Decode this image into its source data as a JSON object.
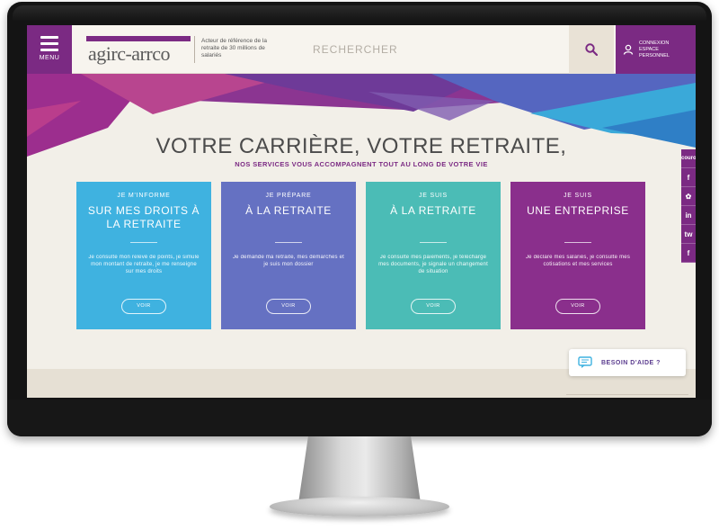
{
  "header": {
    "menu_label": "MENU",
    "logo_text": "agirc-arrco",
    "tagline": "Acteur de référence de la retraite de 30 millions de salariés",
    "search_placeholder": "RECHERCHER",
    "account_label": "CONNEXION ESPACE PERSONNEL"
  },
  "hero": {
    "title": "VOTRE CARRIÈRE, VOTRE RETRAITE,",
    "subtitle": "NOS SERVICES VOUS ACCOMPAGNENT TOUT AU LONG DE VOTRE VIE"
  },
  "cards": [
    {
      "kicker": "JE M'INFORME",
      "title": "SUR MES DROITS À LA RETRAITE",
      "description": "Je consulte mon relevé de points, je simule mon montant de retraite, je me renseigne sur mes droits",
      "cta": "VOIR",
      "color": "#3fb2e0"
    },
    {
      "kicker": "JE PRÉPARE",
      "title": "À LA RETRAITE",
      "description": "Je demande ma retraite, mes démarches et je suis mon dossier",
      "cta": "VOIR",
      "color": "#6571c2"
    },
    {
      "kicker": "JE SUIS",
      "title": "À LA RETRAITE",
      "description": "Je consulte mes paiements, je télécharge mes documents, je signale un changement de situation",
      "cta": "VOIR",
      "color": "#4bbcb6"
    },
    {
      "kicker": "JE SUIS",
      "title": "UNE ENTREPRISE",
      "description": "Je déclare mes salariés, je consulte mes cotisations et mes services",
      "cta": "VOIR",
      "color": "#8a2f8c"
    }
  ],
  "social": [
    "couronne",
    "f",
    "✿",
    "in",
    "tw",
    "f"
  ],
  "help": {
    "label": "BESOIN D'AIDE ?"
  },
  "colors": {
    "brand_purple": "#7b2a83",
    "hero_bg": "#f2efe8",
    "bezel": "#141414"
  }
}
